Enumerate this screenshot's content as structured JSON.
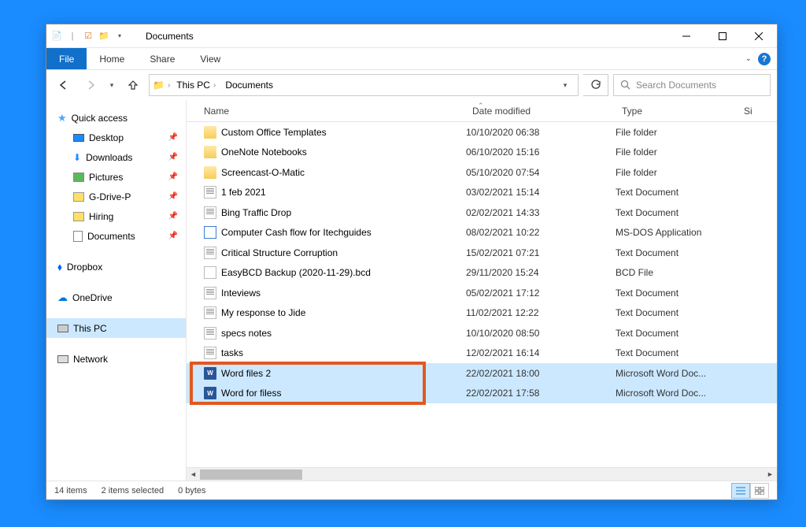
{
  "window": {
    "title": "Documents"
  },
  "ribbon": {
    "file": "File",
    "home": "Home",
    "share": "Share",
    "view": "View"
  },
  "nav": {
    "breadcrumb": [
      {
        "label": "This PC"
      },
      {
        "label": "Documents"
      }
    ]
  },
  "search": {
    "placeholder": "Search Documents"
  },
  "sidebar": {
    "quick_access": "Quick access",
    "quick_items": [
      {
        "label": "Desktop",
        "icon": "desktop"
      },
      {
        "label": "Downloads",
        "icon": "downloads"
      },
      {
        "label": "Pictures",
        "icon": "pictures"
      },
      {
        "label": "G-Drive-P",
        "icon": "gdrive"
      },
      {
        "label": "Hiring",
        "icon": "gdrive"
      },
      {
        "label": "Documents",
        "icon": "documents"
      }
    ],
    "dropbox": "Dropbox",
    "onedrive": "OneDrive",
    "this_pc": "This PC",
    "network": "Network"
  },
  "columns": {
    "name": "Name",
    "date": "Date modified",
    "type": "Type",
    "size": "Si"
  },
  "files": [
    {
      "name": "Custom Office Templates",
      "date": "10/10/2020 06:38",
      "type": "File folder",
      "icon": "folder"
    },
    {
      "name": "OneNote Notebooks",
      "date": "06/10/2020 15:16",
      "type": "File folder",
      "icon": "folder"
    },
    {
      "name": "Screencast-O-Matic",
      "date": "05/10/2020 07:54",
      "type": "File folder",
      "icon": "folder"
    },
    {
      "name": "1 feb 2021",
      "date": "03/02/2021 15:14",
      "type": "Text Document",
      "icon": "txt"
    },
    {
      "name": "Bing Traffic Drop",
      "date": "02/02/2021 14:33",
      "type": "Text Document",
      "icon": "txt"
    },
    {
      "name": "Computer Cash flow for Itechguides",
      "date": "08/02/2021 10:22",
      "type": "MS-DOS Application",
      "icon": "exe"
    },
    {
      "name": "Critical Structure Corruption",
      "date": "15/02/2021 07:21",
      "type": "Text Document",
      "icon": "txt"
    },
    {
      "name": "EasyBCD Backup (2020-11-29).bcd",
      "date": "29/11/2020 15:24",
      "type": "BCD File",
      "icon": "bcd"
    },
    {
      "name": "Inteviews",
      "date": "05/02/2021 17:12",
      "type": "Text Document",
      "icon": "txt"
    },
    {
      "name": "My response to Jide",
      "date": "11/02/2021 12:22",
      "type": "Text Document",
      "icon": "txt"
    },
    {
      "name": "specs notes",
      "date": "10/10/2020 08:50",
      "type": "Text Document",
      "icon": "txt"
    },
    {
      "name": "tasks",
      "date": "12/02/2021 16:14",
      "type": "Text Document",
      "icon": "txt"
    },
    {
      "name": "Word files 2",
      "date": "22/02/2021 18:00",
      "type": "Microsoft Word Doc...",
      "icon": "word",
      "selected": true
    },
    {
      "name": "Word for filess",
      "date": "22/02/2021 17:58",
      "type": "Microsoft Word Doc...",
      "icon": "word",
      "selected": true
    }
  ],
  "status": {
    "items": "14 items",
    "selected": "2 items selected",
    "bytes": "0 bytes"
  }
}
